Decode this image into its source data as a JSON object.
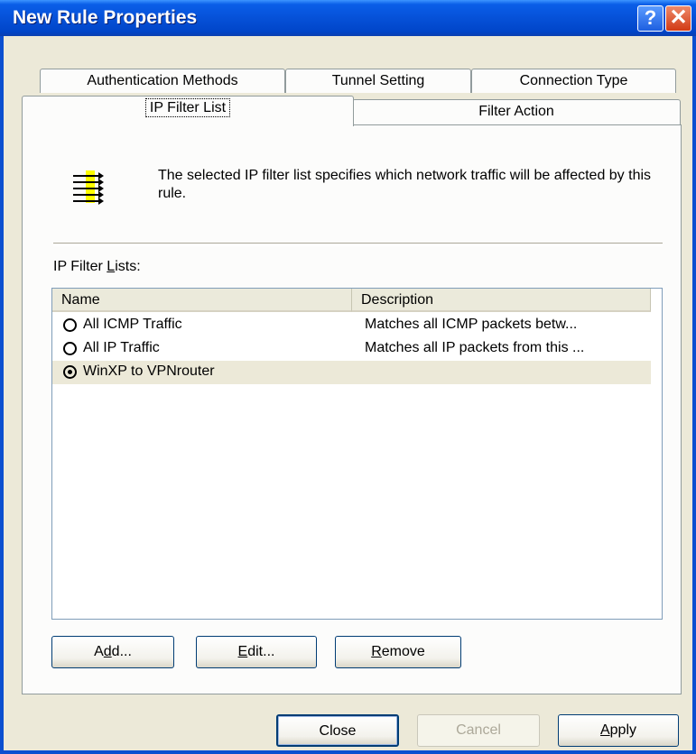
{
  "window": {
    "title": "New Rule Properties",
    "help_glyph": "?",
    "close_glyph": "✕"
  },
  "tabs": {
    "row_back": [
      "Authentication Methods",
      "Tunnel Setting",
      "Connection Type"
    ],
    "row_front": [
      "IP Filter List",
      "Filter Action"
    ],
    "selected": "IP Filter List"
  },
  "panel": {
    "hint_icon": "filter-list-icon",
    "hint_text": "The selected IP filter list specifies which network traffic will be affected by this rule.",
    "list_label_pre": "IP Filter ",
    "list_label_accel": "L",
    "list_label_post": "ists:",
    "columns": [
      "Name",
      "Description"
    ],
    "rows": [
      {
        "name": "All ICMP Traffic",
        "description": "Matches all ICMP packets betw...",
        "checked": false
      },
      {
        "name": "All IP Traffic",
        "description": "Matches all IP packets from this ...",
        "checked": false
      },
      {
        "name": "WinXP to VPNrouter",
        "description": "",
        "checked": true
      }
    ],
    "buttons": {
      "add_accel": "d",
      "add_pre": "A",
      "add_post": "d...",
      "edit_accel": "E",
      "edit_post": "dit...",
      "remove_accel": "R",
      "remove_post": "emove"
    }
  },
  "footer": {
    "close_label": "Close",
    "cancel_label": "Cancel",
    "apply_accel": "A",
    "apply_post": "pply"
  },
  "colors": {
    "titlebar": "#0651d8",
    "dialog_bg": "#ece9d8",
    "icon_highlight": "#ffff00"
  }
}
